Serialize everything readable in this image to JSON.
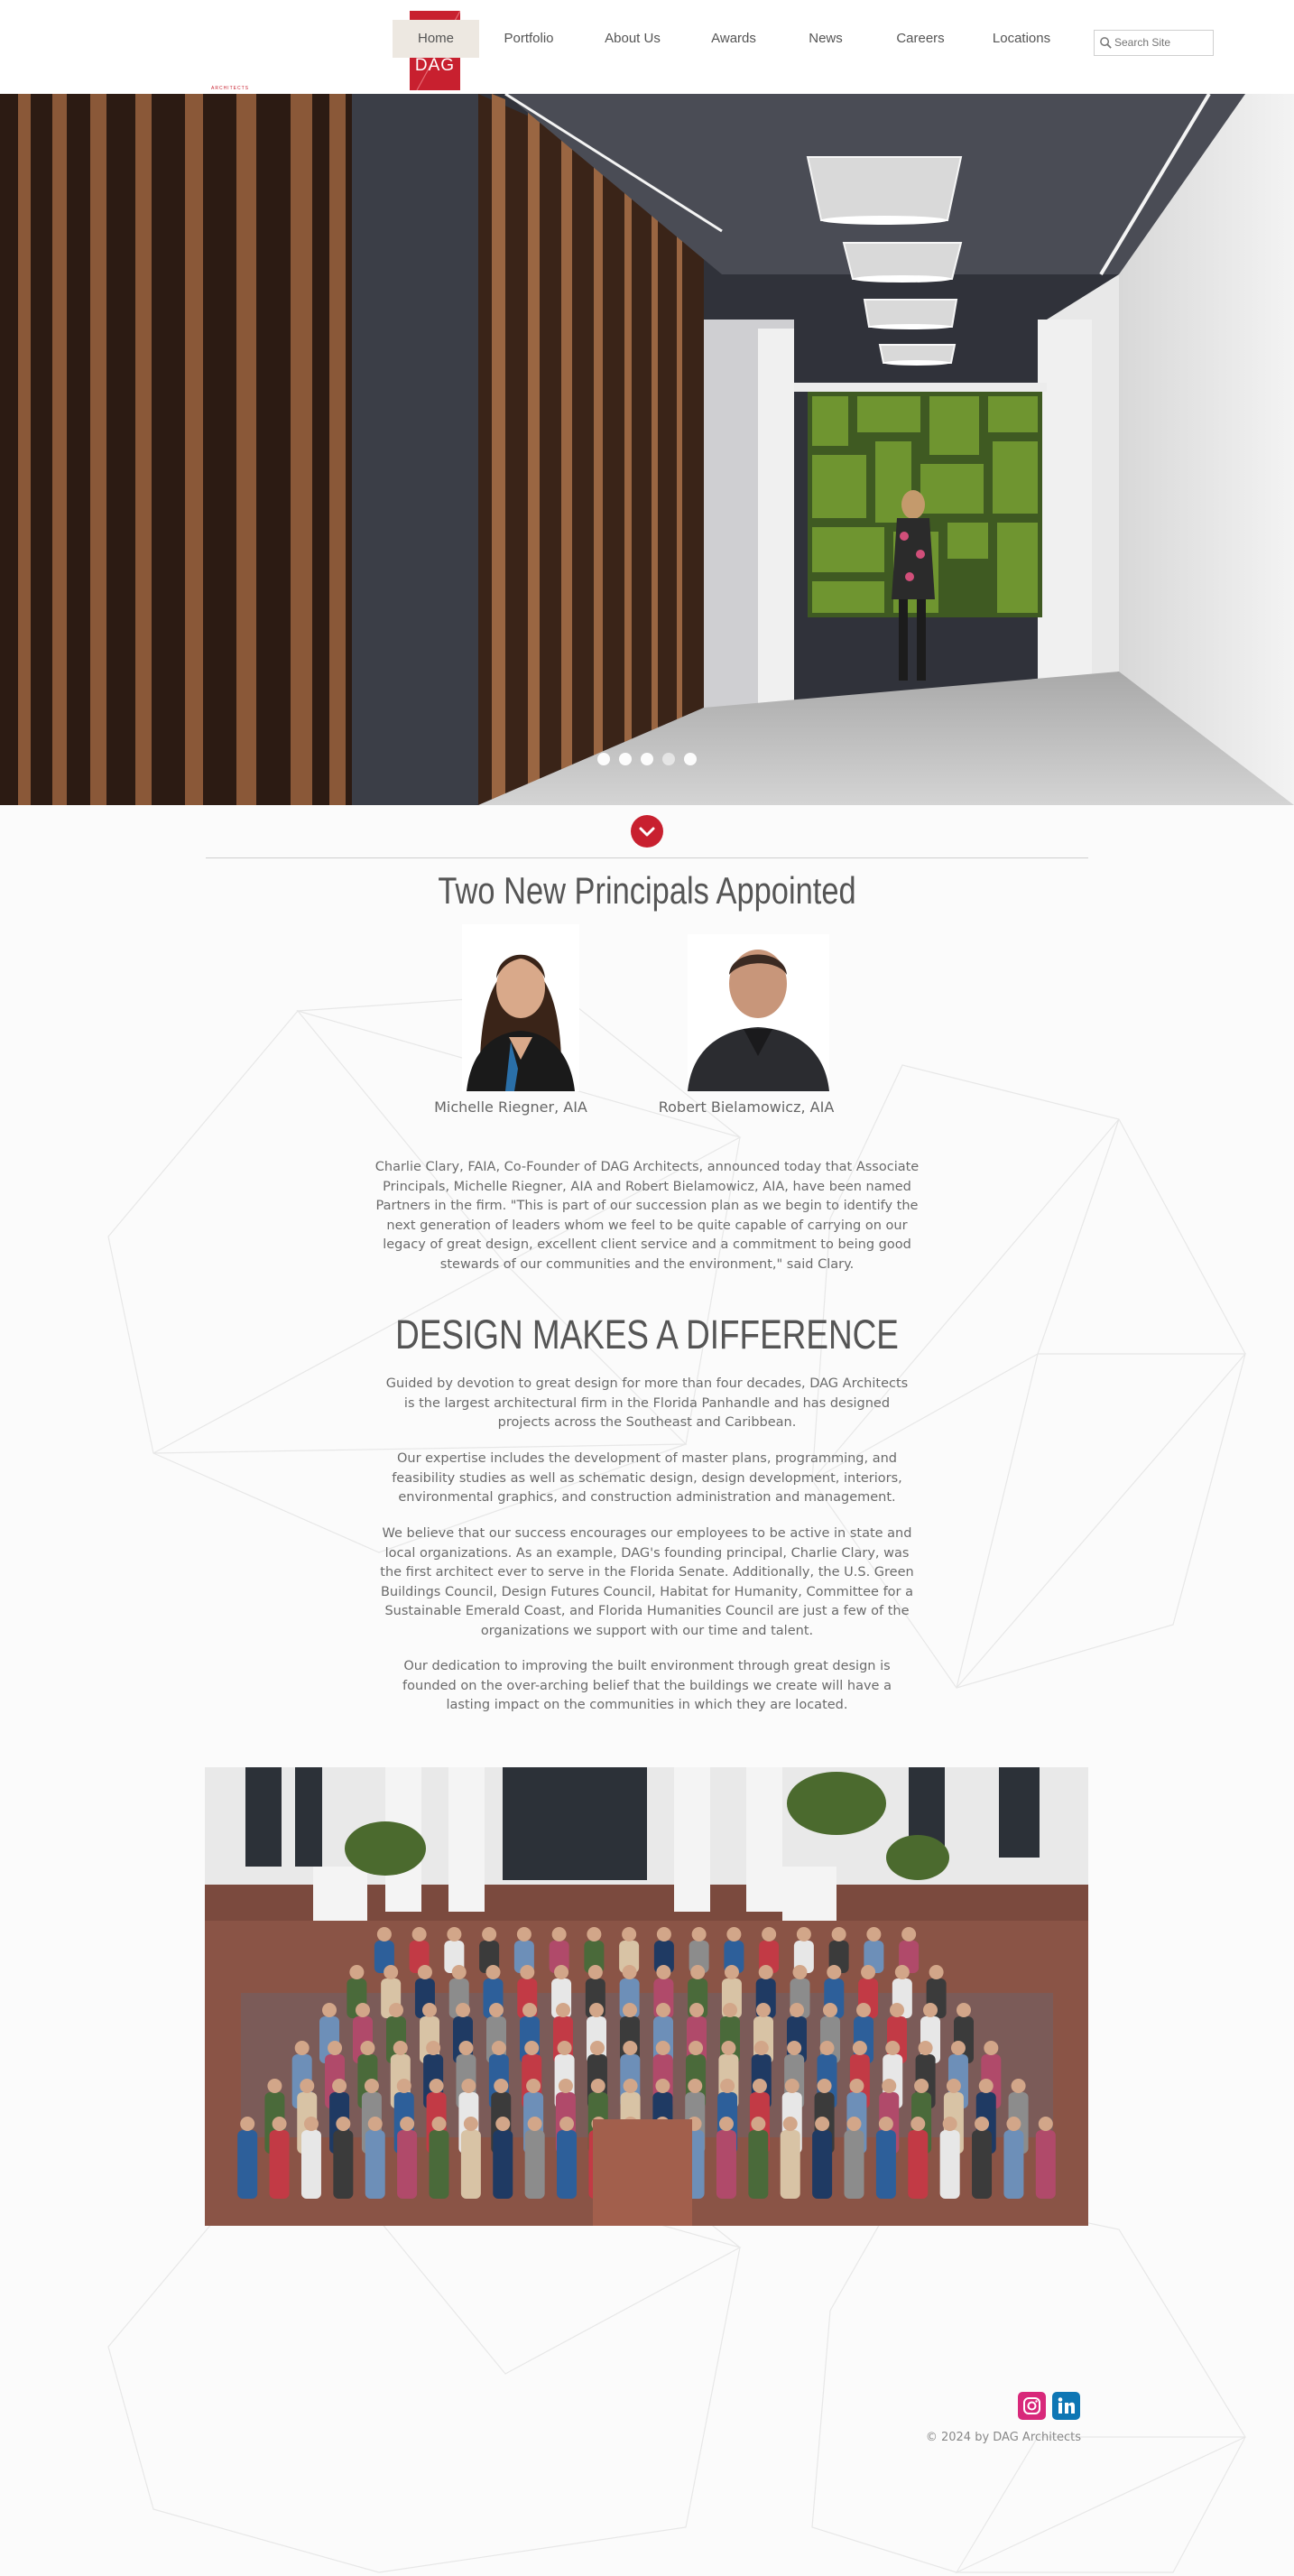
{
  "brand": {
    "logo_text": "DAG",
    "logo_subtext": "ARCHITECTS",
    "accent_color": "#c8202f",
    "nav_active_bg": "#ede8e1"
  },
  "nav": {
    "items": [
      {
        "label": "Home",
        "active": true
      },
      {
        "label": "Portfolio"
      },
      {
        "label": "About Us"
      },
      {
        "label": "Awards"
      },
      {
        "label": "News"
      },
      {
        "label": "Careers"
      },
      {
        "label": "Locations"
      }
    ]
  },
  "search": {
    "placeholder": "Search Site",
    "icon": "search-icon"
  },
  "hero": {
    "slide_count": 5,
    "current_slide": 4,
    "scroll_icon": "chevron-down-icon"
  },
  "announcement": {
    "title": "Two New Principals Appointed",
    "people": [
      {
        "name": "Michelle Riegner, AIA"
      },
      {
        "name": "Robert Bielamowicz, AIA"
      }
    ],
    "body": "Charlie Clary, FAIA, Co-Founder of DAG Architects, announced today that Associate Principals, Michelle Riegner, AIA and Robert Bielamowicz, AIA, have been named Partners in the firm. \"This is part of our succession plan as we begin to identify the next generation of leaders whom we feel to be quite capable of carrying on our legacy of great design, excellent client service and a commitment to being good stewards of our communities and the environment,\" said Clary."
  },
  "about": {
    "title": "DESIGN MAKES A DIFFERENCE",
    "paragraphs": [
      "Guided by devotion to great design for more than four decades, DAG Architects is the largest architectural firm in the Florida Panhandle and has designed projects across the Southeast and Caribbean.",
      "Our expertise includes the development of master plans, programming, and feasibility studies as well as schematic design, design development, interiors, environmental graphics, and construction administration and management.",
      "We believe that our success encourages our employees to be active in state and local organizations. As an example, DAG's founding principal, Charlie Clary, was the first architect ever to serve in the Florida Senate. Additionally, the U.S. Green Buildings Council, Design Futures Council, Habitat for Humanity, Committee for a Sustainable Emerald Coast, and Florida Humanities Council are just a few of the organizations we support with our time and talent.",
      "Our dedication to improving the built environment through great design is founded on the over-arching belief that the buildings we create will have a lasting impact on the communities in which they are located."
    ]
  },
  "footer": {
    "social": [
      {
        "icon": "instagram-icon",
        "color": "#d8287a"
      },
      {
        "icon": "linkedin-icon",
        "color": "#0e76b4"
      }
    ],
    "copyright": "© 2024 by DAG Architects"
  }
}
